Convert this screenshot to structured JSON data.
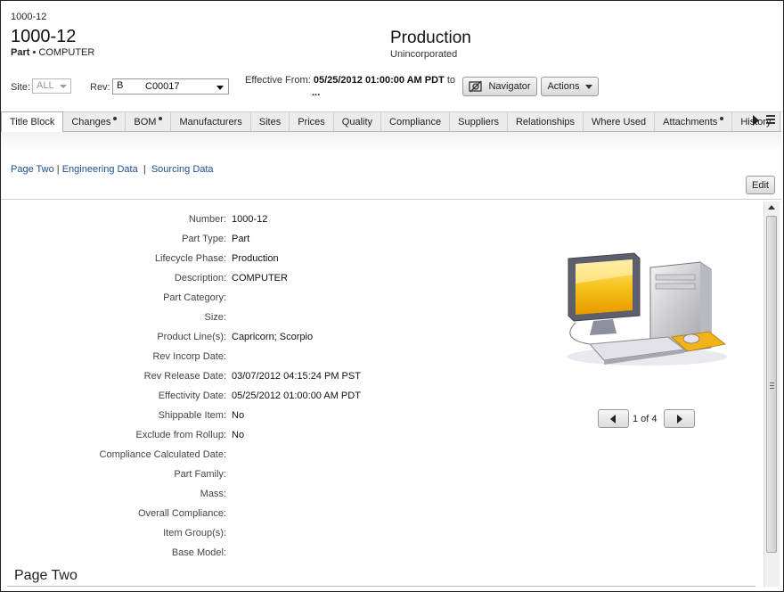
{
  "header": {
    "breadcrumb": "1000-12",
    "title": "1000-12",
    "type": "Part",
    "bullet": "•",
    "description": "COMPUTER",
    "status": "Production",
    "status_sub": "Unincorporated"
  },
  "controls": {
    "site_label": "Site:",
    "site_value": "ALL",
    "rev_label": "Rev:",
    "rev_value": "B",
    "rev_change": "C00017",
    "effective_label": "Effective From:",
    "effective_value": "05/25/2012 01:00:00 AM PDT",
    "effective_to": "to",
    "effective_more": "...",
    "navigator_label": "Navigator",
    "actions_label": "Actions"
  },
  "tabs": [
    {
      "label": "Title Block",
      "active": true,
      "dot": false
    },
    {
      "label": "Changes",
      "active": false,
      "dot": true
    },
    {
      "label": "BOM",
      "active": false,
      "dot": true
    },
    {
      "label": "Manufacturers",
      "active": false,
      "dot": false
    },
    {
      "label": "Sites",
      "active": false,
      "dot": false
    },
    {
      "label": "Prices",
      "active": false,
      "dot": false
    },
    {
      "label": "Quality",
      "active": false,
      "dot": false
    },
    {
      "label": "Compliance",
      "active": false,
      "dot": false
    },
    {
      "label": "Suppliers",
      "active": false,
      "dot": false
    },
    {
      "label": "Relationships",
      "active": false,
      "dot": false
    },
    {
      "label": "Where Used",
      "active": false,
      "dot": false
    },
    {
      "label": "Attachments",
      "active": false,
      "dot": true
    },
    {
      "label": "History",
      "active": false,
      "dot": false
    }
  ],
  "links": {
    "page_two": "Page Two",
    "sep1": "|",
    "engineering": "Engineering Data",
    "sep2": "|",
    "sourcing": "Sourcing Data"
  },
  "edit_label": "Edit",
  "fields": [
    {
      "label": "Number:",
      "value": "1000-12"
    },
    {
      "label": "Part Type:",
      "value": "Part"
    },
    {
      "label": "Lifecycle Phase:",
      "value": "Production"
    },
    {
      "label": "Description:",
      "value": "COMPUTER"
    },
    {
      "label": "Part Category:",
      "value": ""
    },
    {
      "label": "Size:",
      "value": ""
    },
    {
      "label": "Product Line(s):",
      "value": "Capricorn; Scorpio"
    },
    {
      "label": "Rev Incorp Date:",
      "value": ""
    },
    {
      "label": "Rev Release Date:",
      "value": "03/07/2012 04:15:24 PM PST"
    },
    {
      "label": "Effectivity Date:",
      "value": "05/25/2012 01:00:00 AM PDT"
    },
    {
      "label": "Shippable Item:",
      "value": "No"
    },
    {
      "label": "Exclude from Rollup:",
      "value": "No"
    },
    {
      "label": "Compliance Calculated Date:",
      "value": ""
    },
    {
      "label": "Part Family:",
      "value": ""
    },
    {
      "label": "Mass:",
      "value": ""
    },
    {
      "label": "Overall Compliance:",
      "value": ""
    },
    {
      "label": "Item Group(s):",
      "value": ""
    },
    {
      "label": "Base Model:",
      "value": ""
    }
  ],
  "image_pager": "1 of 4",
  "section_title": "Page Two",
  "icons": {
    "navigator": "navigator-icon",
    "image": "computer-image"
  },
  "colors": {
    "link": "#1d4e8f",
    "screen": "#f5b400"
  }
}
